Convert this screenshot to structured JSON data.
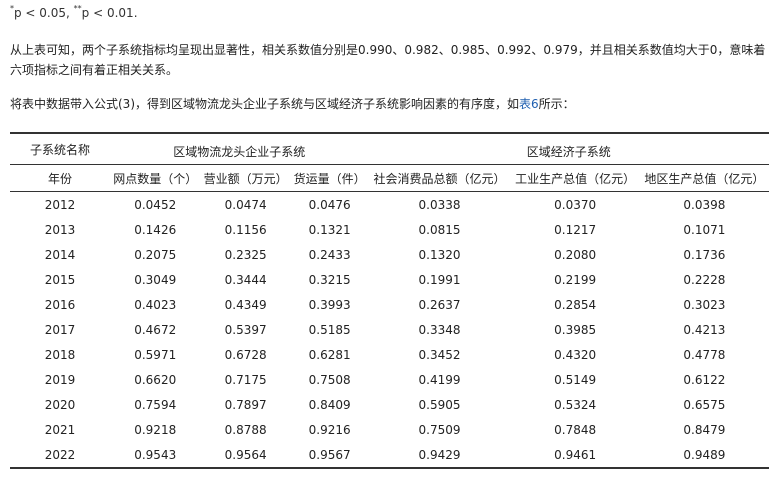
{
  "footnote": {
    "sig1_mark": "*",
    "sig1_text": "p < 0.05,",
    "sig2_mark": "**",
    "sig2_text": "p < 0.01."
  },
  "paragraph1": "从上表可知，两个子系统指标均呈现出显著性，相关系数值分别是0.990、0.982、0.985、0.992、0.979，并且相关系数值均大于0，意味着六项指标之间有着正相关关系。",
  "paragraph2": {
    "before": "将表中数据带入公式(3)，得到区域物流龙头企业子系统与区域经济子系统影响因素的有序度，如",
    "link": "表6",
    "after": "所示："
  },
  "table": {
    "header_row1": {
      "subsystem_label": "子系统名称",
      "group1": "区域物流龙头企业子系统",
      "group2": "区域经济子系统"
    },
    "columns": [
      "年份",
      "网点数量（个）",
      "营业额（万元）",
      "货运量（件）",
      "社会消费品总额（亿元）",
      "工业生产总值（亿元）",
      "地区生产总值（亿元）"
    ],
    "rows": [
      [
        "2012",
        "0.0452",
        "0.0474",
        "0.0476",
        "0.0338",
        "0.0370",
        "0.0398"
      ],
      [
        "2013",
        "0.1426",
        "0.1156",
        "0.1321",
        "0.0815",
        "0.1217",
        "0.1071"
      ],
      [
        "2014",
        "0.2075",
        "0.2325",
        "0.2433",
        "0.1320",
        "0.2080",
        "0.1736"
      ],
      [
        "2015",
        "0.3049",
        "0.3444",
        "0.3215",
        "0.1991",
        "0.2199",
        "0.2228"
      ],
      [
        "2016",
        "0.4023",
        "0.4349",
        "0.3993",
        "0.2637",
        "0.2854",
        "0.3023"
      ],
      [
        "2017",
        "0.4672",
        "0.5397",
        "0.5185",
        "0.3348",
        "0.3985",
        "0.4213"
      ],
      [
        "2018",
        "0.5971",
        "0.6728",
        "0.6281",
        "0.3452",
        "0.4320",
        "0.4778"
      ],
      [
        "2019",
        "0.6620",
        "0.7175",
        "0.7508",
        "0.4199",
        "0.5149",
        "0.6122"
      ],
      [
        "2020",
        "0.7594",
        "0.7897",
        "0.8409",
        "0.5905",
        "0.5324",
        "0.6575"
      ],
      [
        "2021",
        "0.9218",
        "0.8788",
        "0.9216",
        "0.7509",
        "0.7848",
        "0.8479"
      ],
      [
        "2022",
        "0.9543",
        "0.9564",
        "0.9567",
        "0.9429",
        "0.9461",
        "0.9489"
      ]
    ]
  }
}
